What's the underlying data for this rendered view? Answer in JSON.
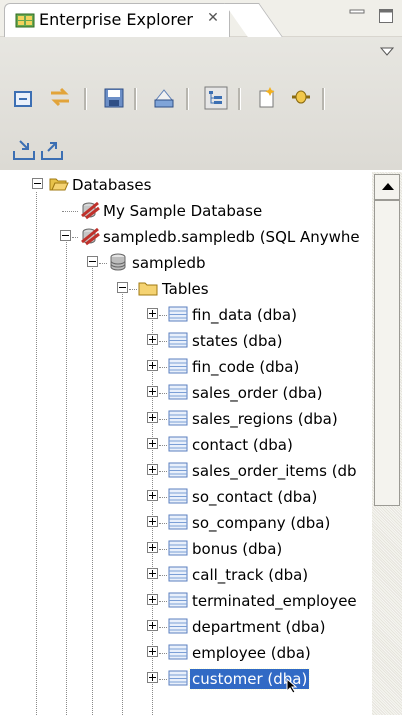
{
  "view": {
    "title": "Enterprise Explorer",
    "close_glyph": "✕"
  },
  "icons": {
    "tab": "database-explorer-icon",
    "toolbar": [
      "collapse-all-icon",
      "link-with-editor-icon",
      "save-icon",
      "print-icon",
      "hierarchy-icon",
      "new-file-icon",
      "plug-icon",
      "import-icon",
      "export-icon"
    ]
  },
  "tree": {
    "nodes": [
      {
        "label": "Databases"
      },
      {
        "label": "My Sample Database"
      },
      {
        "label": "sampledb.sampledb (SQL Anywhe"
      },
      {
        "label": "sampledb"
      },
      {
        "label": "Tables"
      },
      {
        "label": "fin_data (dba)"
      },
      {
        "label": "states (dba)"
      },
      {
        "label": "fin_code (dba)"
      },
      {
        "label": "sales_order (dba)"
      },
      {
        "label": "sales_regions (dba)"
      },
      {
        "label": "contact (dba)"
      },
      {
        "label": "sales_order_items (db"
      },
      {
        "label": "so_contact (dba)"
      },
      {
        "label": "so_company (dba)"
      },
      {
        "label": "bonus (dba)"
      },
      {
        "label": "call_track (dba)"
      },
      {
        "label": "terminated_employee"
      },
      {
        "label": "department (dba)"
      },
      {
        "label": "employee (dba)"
      },
      {
        "label": "customer (dba)"
      }
    ],
    "selected": "customer (dba)"
  },
  "colors": {
    "selection": "#316ac5",
    "folder": "#f5d372",
    "table": "#7b9fd6",
    "connection": "#c0312b"
  }
}
